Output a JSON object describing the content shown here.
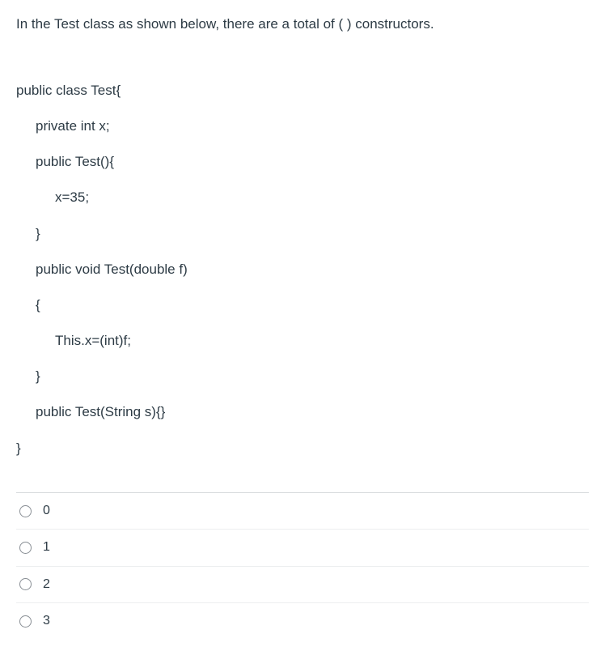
{
  "question": "In the Test class as shown below, there are a total of ( ) constructors.",
  "code": {
    "l1": "public class Test{",
    "l2": "private int x;",
    "l3": "public Test(){",
    "l4": "x=35;",
    "l5": "}",
    "l6": "public void Test(double f)",
    "l7": "{",
    "l8": "This.x=(int)f;",
    "l9": "}",
    "l10": "public Test(String s){}",
    "l11": "}"
  },
  "options": [
    {
      "label": "0"
    },
    {
      "label": "1"
    },
    {
      "label": "2"
    },
    {
      "label": "3"
    }
  ]
}
